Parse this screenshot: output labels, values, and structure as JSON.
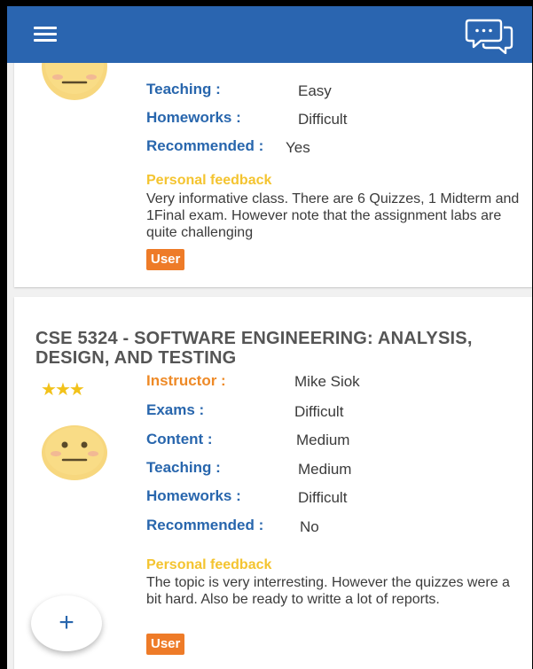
{
  "colors": {
    "toolbar": "#2a65b0",
    "label_blue": "#2866ad",
    "label_orange": "#ee8a27",
    "feedback_title": "#f4c430",
    "badge": "#ee7b28",
    "star": "#f2c21a"
  },
  "toolbar": {
    "menu_icon": "hamburger-menu-icon",
    "chat_icon": "chat-bubble-icon"
  },
  "card1": {
    "face_icon": "neutral-face-icon",
    "teaching_label": "Teaching :",
    "teaching_value": "Easy",
    "homeworks_label": "Homeworks :",
    "homeworks_value": "Difficult",
    "recommended_label": "Recommended :",
    "recommended_value": "Yes",
    "feedback_title": "Personal feedback",
    "feedback_text": "Very informative class. There are 6 Quizzes, 1 Midterm and 1Final exam. However note that the assignment labs are quite challenging",
    "badge": "User"
  },
  "card2": {
    "title": "CSE 5324 - SOFTWARE ENGINEERING: ANALYSIS, DESIGN, AND TESTING",
    "rating_stars": 3,
    "face_icon": "neutral-face-icon",
    "instructor_label": "Instructor :",
    "instructor_value": "Mike Siok",
    "exams_label": "Exams :",
    "exams_value": "Difficult",
    "content_label": "Content :",
    "content_value": "Medium",
    "teaching_label": "Teaching :",
    "teaching_value": "Medium",
    "homeworks_label": "Homeworks :",
    "homeworks_value": "Difficult",
    "recommended_label": "Recommended :",
    "recommended_value": "No",
    "feedback_title": "Personal feedback",
    "feedback_text": "The topic is very interresting. However the quizzes were a bit hard. Also be ready to writte a lot of reports.",
    "badge": "User"
  },
  "fab": {
    "label": "+",
    "icon": "add-icon"
  }
}
